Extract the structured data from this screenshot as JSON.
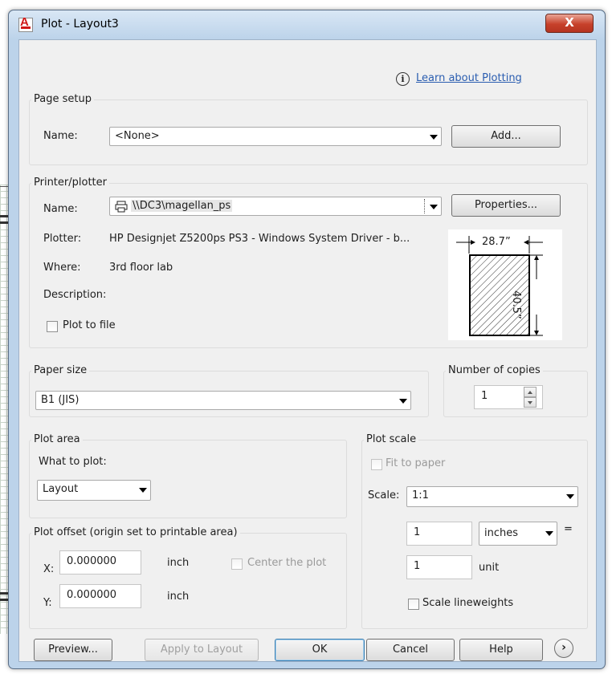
{
  "window": {
    "title": "Plot - Layout3",
    "close_glyph": "X",
    "app_icon_glyph": "A"
  },
  "help_link": {
    "icon_glyph": "i",
    "label": "Learn about Plotting"
  },
  "page_setup": {
    "group_label": "Page setup",
    "name_label": "Name:",
    "name_value": "<None>",
    "add_button": "Add..."
  },
  "printer": {
    "group_label": "Printer/plotter",
    "name_label": "Name:",
    "name_value": "\\\\DC3\\magellan_ps",
    "properties_button": "Properties...",
    "plotter_label": "Plotter:",
    "plotter_value": "HP Designjet Z5200ps PS3 - Windows System Driver - b...",
    "where_label": "Where:",
    "where_value": "3rd floor lab",
    "description_label": "Description:",
    "plot_to_file_label": "Plot to file",
    "plot_to_file_checked": false,
    "preview_width": "28.7”",
    "preview_height": "40.5”"
  },
  "paper_size": {
    "group_label": "Paper size",
    "value": "B1 (JIS)"
  },
  "copies": {
    "group_label": "Number of copies",
    "value": "1"
  },
  "plot_area": {
    "group_label": "Plot area",
    "what_label": "What to plot:",
    "what_value": "Layout"
  },
  "plot_offset": {
    "group_label": "Plot offset (origin set to printable area)",
    "x_label": "X:",
    "x_value": "0.000000",
    "x_unit": "inch",
    "y_label": "Y:",
    "y_value": "0.000000",
    "y_unit": "inch",
    "center_label": "Center the plot",
    "center_checked": false
  },
  "plot_scale": {
    "group_label": "Plot scale",
    "fit_label": "Fit to paper",
    "fit_checked": false,
    "scale_label": "Scale:",
    "scale_value": "1:1",
    "inches_value": "1",
    "inches_unit": "inches",
    "equals": "=",
    "unit_value": "1",
    "unit_label": "unit",
    "lineweights_label": "Scale lineweights",
    "lineweights_checked": false
  },
  "footer": {
    "preview": "Preview...",
    "apply": "Apply to Layout",
    "ok": "OK",
    "cancel": "Cancel",
    "help": "Help",
    "expand_glyph": "›"
  }
}
